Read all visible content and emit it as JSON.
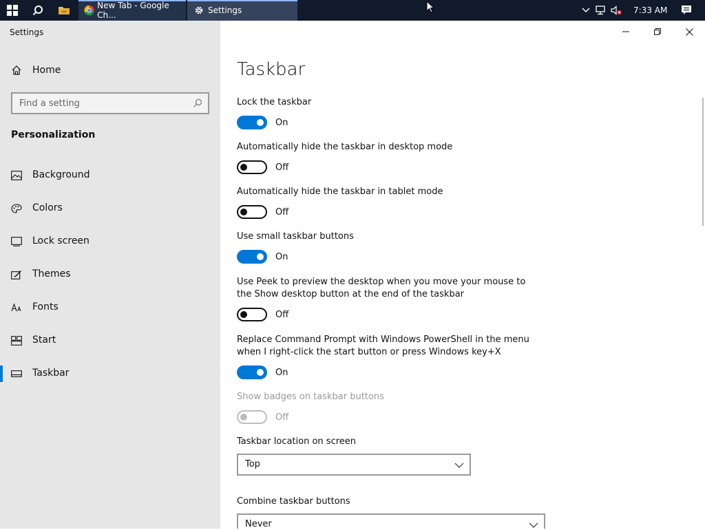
{
  "taskbar": {
    "apps": [
      {
        "title": "New Tab - Google Ch..."
      },
      {
        "title": "Settings"
      }
    ],
    "clock": "7:33 AM"
  },
  "window": {
    "title": "Settings"
  },
  "sidebar": {
    "home_label": "Home",
    "search_placeholder": "Find a setting",
    "section_title": "Personalization",
    "items": [
      {
        "label": "Background",
        "icon": "picture-icon"
      },
      {
        "label": "Colors",
        "icon": "palette-icon"
      },
      {
        "label": "Lock screen",
        "icon": "lock-screen-icon"
      },
      {
        "label": "Themes",
        "icon": "themes-icon"
      },
      {
        "label": "Fonts",
        "icon": "fonts-icon"
      },
      {
        "label": "Start",
        "icon": "start-icon"
      },
      {
        "label": "Taskbar",
        "icon": "taskbar-icon",
        "selected": true
      }
    ]
  },
  "main": {
    "title": "Taskbar",
    "settings": [
      {
        "label": "Lock the taskbar",
        "state": "On"
      },
      {
        "label": "Automatically hide the taskbar in desktop mode",
        "state": "Off"
      },
      {
        "label": "Automatically hide the taskbar in tablet mode",
        "state": "Off"
      },
      {
        "label": "Use small taskbar buttons",
        "state": "On"
      },
      {
        "label": "Use Peek to preview the desktop when you move your mouse to the Show desktop button at the end of the taskbar",
        "state": "Off"
      },
      {
        "label": "Replace Command Prompt with Windows PowerShell in the menu when I right-click the start button or press Windows key+X",
        "state": "On"
      },
      {
        "label": "Show badges on taskbar buttons",
        "state": "Off",
        "disabled": true
      }
    ],
    "location": {
      "label": "Taskbar location on screen",
      "value": "Top"
    },
    "combine": {
      "label": "Combine taskbar buttons",
      "value": "Never"
    }
  },
  "colors": {
    "accent": "#0078d7",
    "taskbar": "#101a2a",
    "sidebar": "#e6e6e6"
  }
}
